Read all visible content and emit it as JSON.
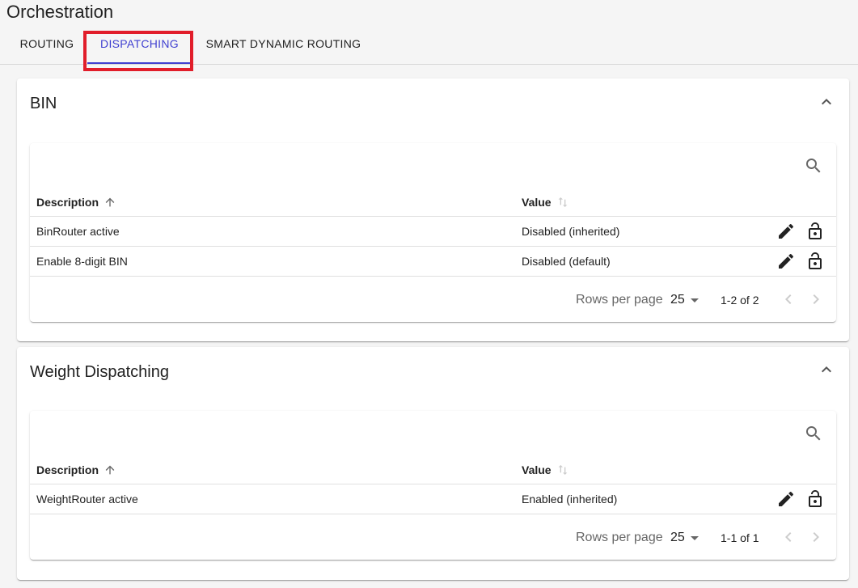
{
  "page": {
    "title": "Orchestration"
  },
  "tabs": [
    {
      "label": "ROUTING"
    },
    {
      "label": "DISPATCHING"
    },
    {
      "label": "SMART DYNAMIC ROUTING"
    }
  ],
  "active_tab_color": "#3f3fd0",
  "highlight_color": "#e11d2a",
  "sections": [
    {
      "title": "BIN",
      "columns": {
        "description": "Description",
        "value": "Value"
      },
      "rows": [
        {
          "description": "BinRouter active",
          "value": "Disabled (inherited)"
        },
        {
          "description": "Enable 8-digit BIN",
          "value": "Disabled (default)"
        }
      ],
      "pagination": {
        "rows_per_page_label": "Rows per page",
        "rows_per_page": "25",
        "range": "1-2 of 2"
      }
    },
    {
      "title": "Weight Dispatching",
      "columns": {
        "description": "Description",
        "value": "Value"
      },
      "rows": [
        {
          "description": "WeightRouter active",
          "value": "Enabled (inherited)"
        }
      ],
      "pagination": {
        "rows_per_page_label": "Rows per page",
        "rows_per_page": "25",
        "range": "1-1 of 1"
      }
    }
  ],
  "icons": {
    "collapse": "chevron-up-icon",
    "search": "search-icon",
    "sort_asc": "arrow-up-icon",
    "sort_neutral": "sort-icon",
    "edit": "pencil-icon",
    "lock": "lock-open-icon",
    "dropdown": "caret-down-icon",
    "prev": "chevron-left-icon",
    "next": "chevron-right-icon"
  }
}
